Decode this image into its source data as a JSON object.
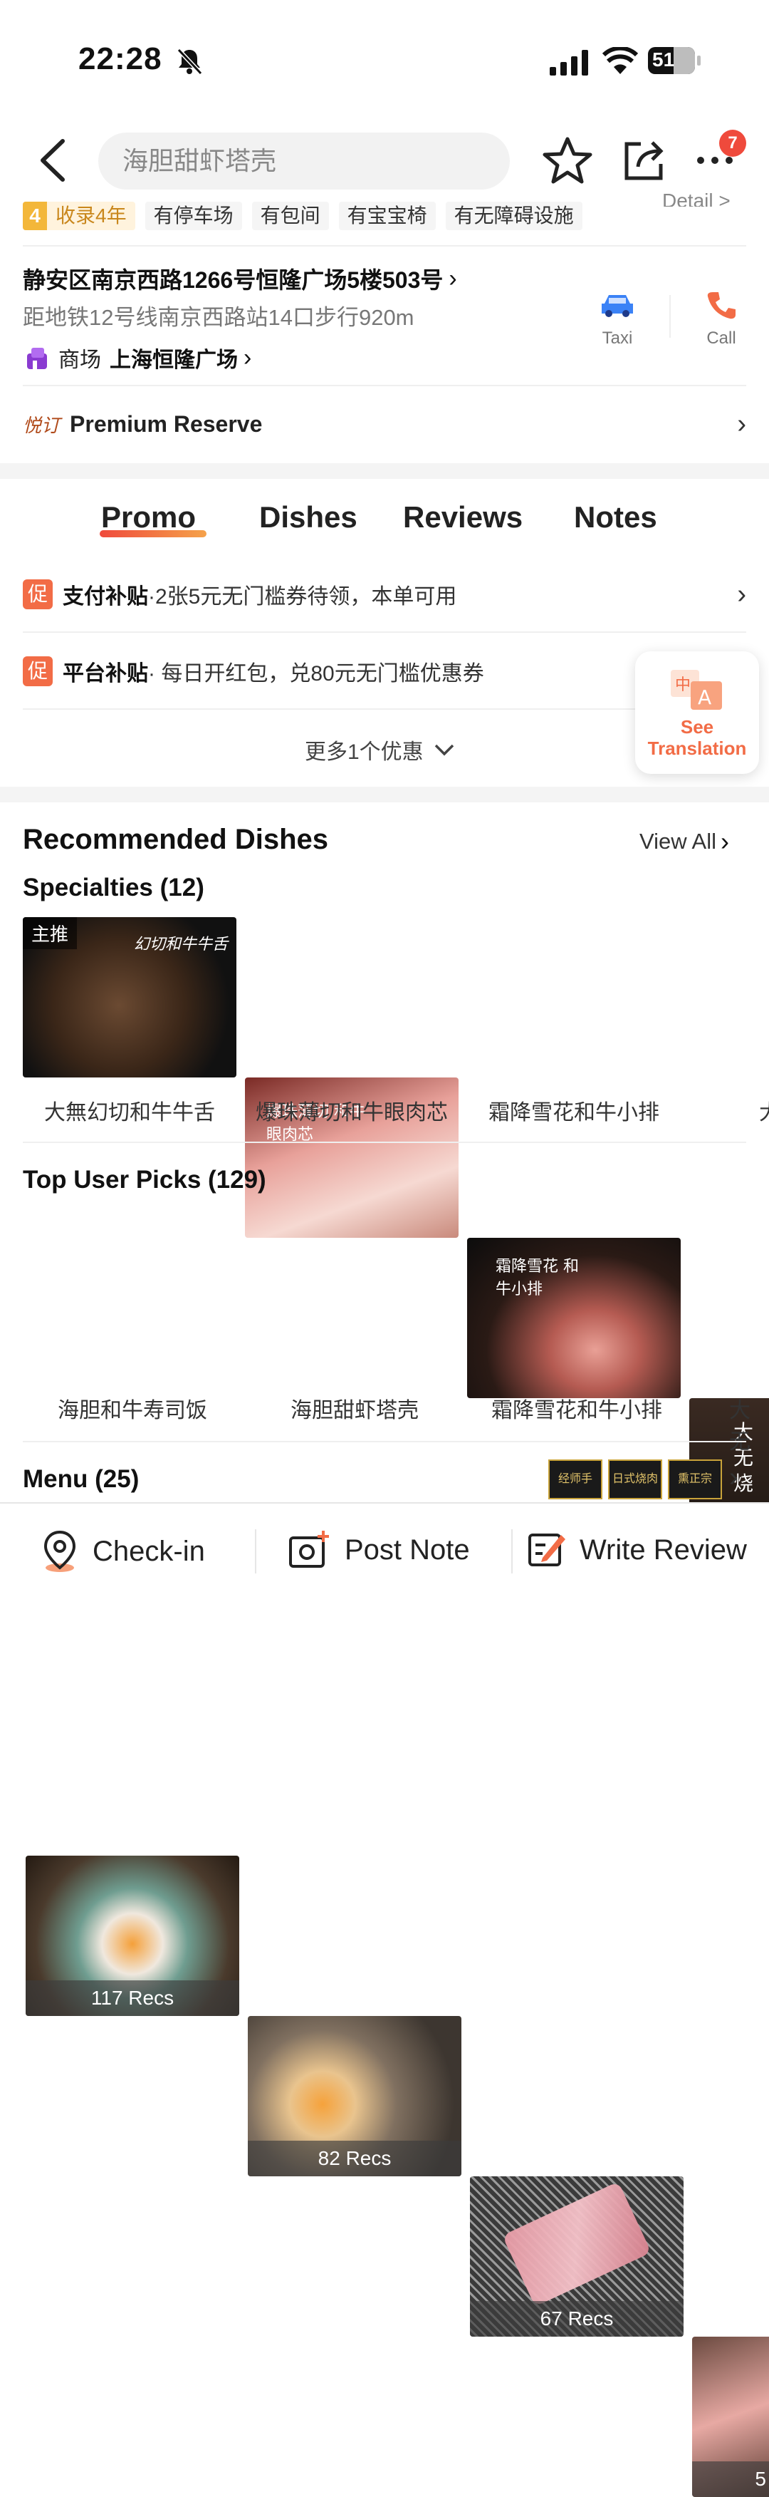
{
  "status_bar": {
    "time": "22:28",
    "battery": "51"
  },
  "header": {
    "search_placeholder": "海胆甜虾塔壳",
    "more_badge": "7"
  },
  "tags": {
    "years_num": "4",
    "years_label": "收录4年",
    "items": [
      "有停车场",
      "有包间",
      "有宝宝椅",
      "有无障碍设施"
    ],
    "detail_link": "Detail >"
  },
  "address": {
    "line": "静安区南京西路1266号恒隆广场5楼503号",
    "metro": "距地铁12号线南京西路站14口步行920m",
    "mall_label": "商场",
    "mall_name": "上海恒隆广场",
    "taxi_label": "Taxi",
    "call_label": "Call"
  },
  "premium": {
    "logo": "悦订",
    "label": "Premium Reserve"
  },
  "tabs": [
    "Promo",
    "Dishes",
    "Reviews",
    "Notes"
  ],
  "promos": [
    {
      "icon": "促",
      "title": "支付补贴",
      "text": "·2张5元无门槛券待领，本单可用"
    },
    {
      "icon": "促",
      "title": "平台补贴",
      "text": "· 每日开红包，兑80元无门槛优惠券"
    }
  ],
  "more_promos": "更多1个优惠",
  "translation": {
    "icon": "中A",
    "label_line1": "See",
    "label_line2": "Translation"
  },
  "recommended": {
    "title": "Recommended Dishes",
    "view_all": "View All",
    "specialties_title": "Specialties (12)",
    "specialties": [
      {
        "badge": "主推",
        "overlay": "幻切和牛牛舌",
        "name": "大無幻切和牛牛舌"
      },
      {
        "overlay": "爆珠薄切 和牛眼肉芯",
        "name": "爆珠薄切和牛眼肉芯"
      },
      {
        "overlay": "霜降雪花 和牛小排",
        "name": "霜降雪花和牛小排"
      },
      {
        "overlay": "大无烧",
        "name": "大"
      }
    ],
    "top_picks_title": "Top User Picks (129)",
    "top_picks": [
      {
        "recs": "117 Recs",
        "name": "海胆和牛寿司饭"
      },
      {
        "recs": "82 Recs",
        "name": "海胆甜虾塔壳"
      },
      {
        "recs": "67 Recs",
        "name": "霜降雪花和牛小排"
      },
      {
        "recs": "5",
        "name": "大无"
      }
    ]
  },
  "menu": {
    "title": "Menu (25)",
    "thumbs": [
      "经师手",
      "日式烧肉",
      "熏正宗"
    ]
  },
  "bottom_bar": {
    "checkin": "Check-in",
    "post_note": "Post Note",
    "write_review": "Write Review"
  },
  "colors": {
    "accent": "#f26c46",
    "tab_underline": "#ef4a3c",
    "taxi_blue": "#3b82f6"
  }
}
